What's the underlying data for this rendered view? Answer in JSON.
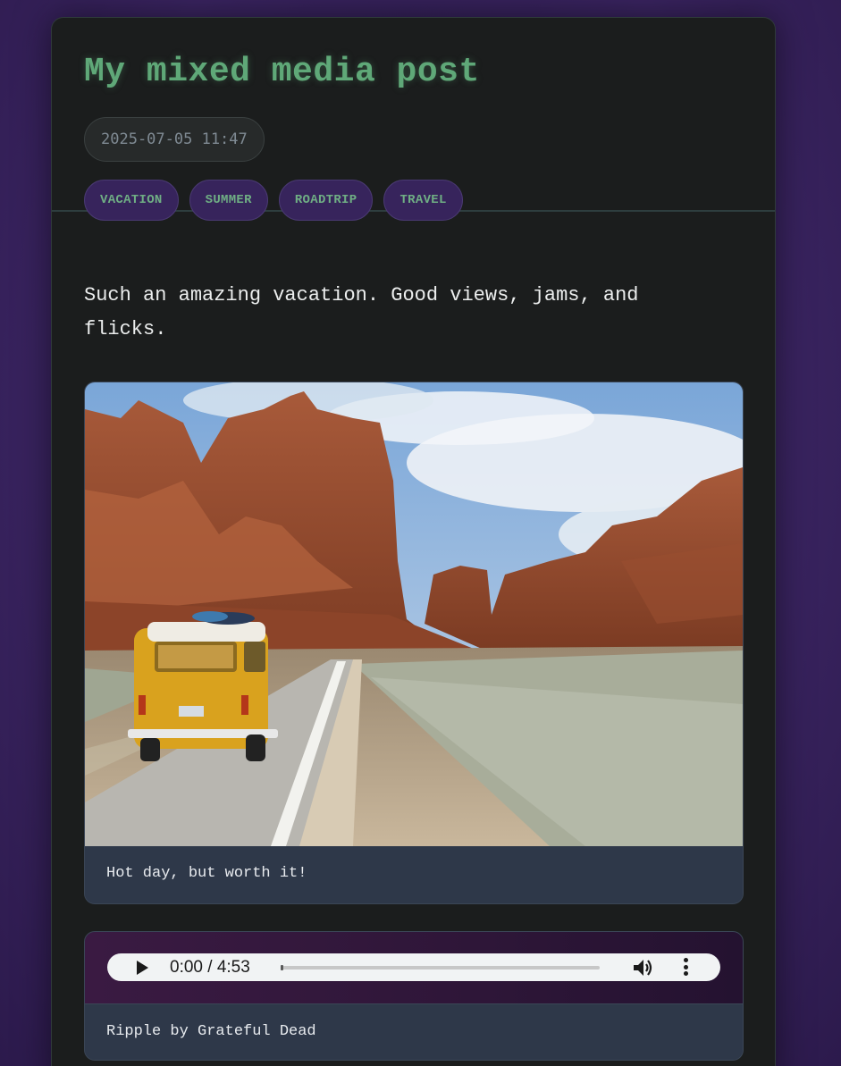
{
  "post": {
    "title": "My mixed media post",
    "date": "2025-07-05 11:47",
    "tags": [
      "VACATION",
      "SUMMER",
      "ROADTRIP",
      "TRAVEL"
    ],
    "body": "Such an amazing vacation. Good views, jams, and flicks."
  },
  "image_block": {
    "caption": "Hot day, but worth it!"
  },
  "audio_block": {
    "time": "0:00 / 4:53",
    "progress": 0,
    "caption": "Ripple by Grateful Dead"
  },
  "colors": {
    "accent_green": "#5fa878",
    "tag_bg": "#37245c",
    "card_bg": "#1b1d1d",
    "caption_bg": "#2e3849"
  }
}
